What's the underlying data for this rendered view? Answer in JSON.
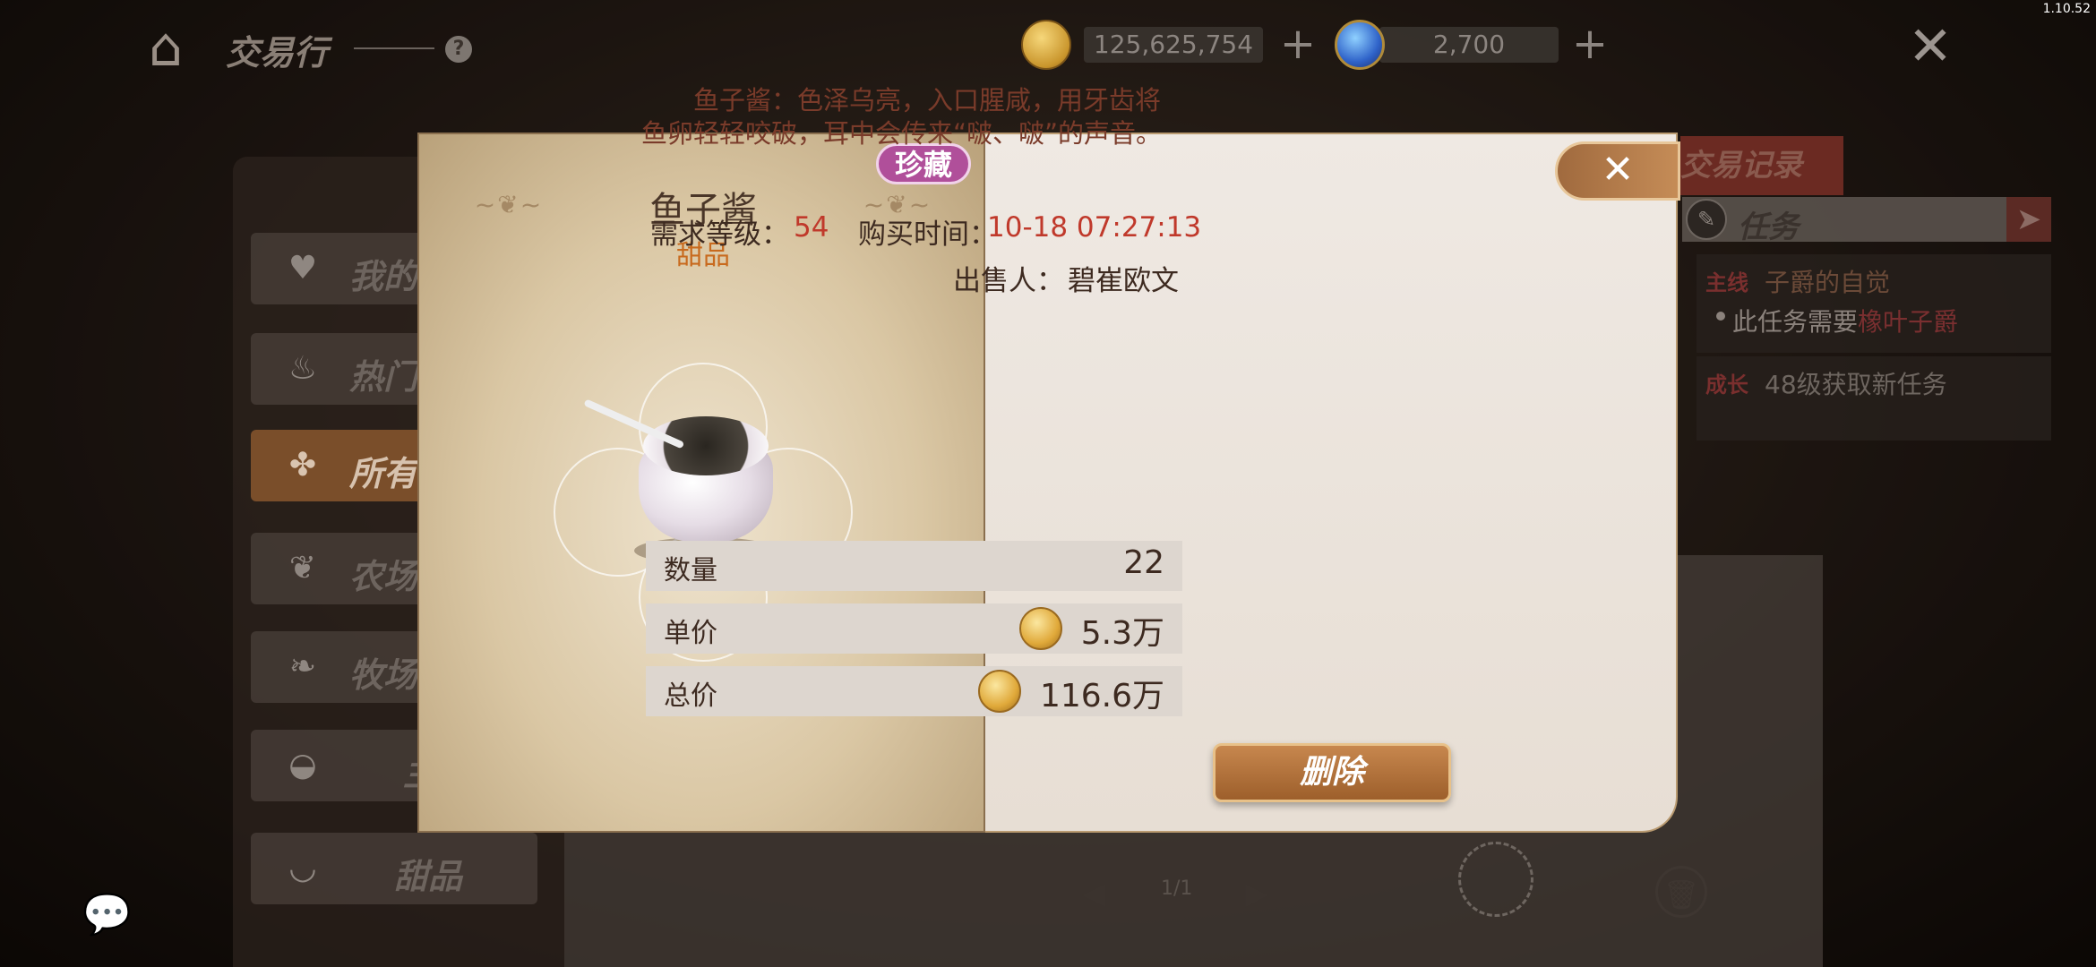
{
  "version": "1.10.52",
  "header": {
    "title": "交易行",
    "gold_amount": "125,625,754",
    "gem_amount": "2,700"
  },
  "sidebar": {
    "items": [
      {
        "label": "我的",
        "icon": "heart-icon"
      },
      {
        "label": "热门",
        "icon": "flame-icon"
      },
      {
        "label": "所有",
        "icon": "clover-icon"
      },
      {
        "label": "农场",
        "icon": "wheat-icon"
      },
      {
        "label": "牧场",
        "icon": "rooster-icon"
      },
      {
        "label": "主",
        "icon": "pot-icon"
      },
      {
        "label": "甜品",
        "icon": "dessert-icon"
      }
    ]
  },
  "trade_record": {
    "tab_label": "交易记录"
  },
  "tasks": {
    "title": "任务",
    "main": {
      "tag": "主线",
      "name": "子爵的自觉",
      "desc_prefix": "此任务需要",
      "desc_highlight": "橡叶子爵"
    },
    "growth": {
      "tag": "成长",
      "text": "48级获取新任务"
    }
  },
  "pager": {
    "text": "1/1"
  },
  "modal": {
    "rarity_badge": "珍藏",
    "item_name": "鱼子酱",
    "category": "甜品",
    "description": "鱼子酱：色泽乌亮，入口腥咸，用牙齿将鱼卵轻轻咬破，耳中会传来“啵、啵”的声音。",
    "level_label": "需求等级：",
    "level_value": "54",
    "time_label": "购买时间：",
    "time_value": "10-18 07:27:13",
    "seller_label": "出售人：",
    "seller_value": "碧崔欧文",
    "quantity_label": "数量",
    "quantity_value": "22",
    "unit_price_label": "单价",
    "unit_price_value": "5.3万",
    "total_price_label": "总价",
    "total_price_value": "116.6万",
    "delete_label": "删除"
  },
  "colors": {
    "accent_red": "#c0392b",
    "category_orange": "#c86a1e",
    "rarity_purple": "#b04f9a",
    "button_brown": "#a56a38"
  }
}
